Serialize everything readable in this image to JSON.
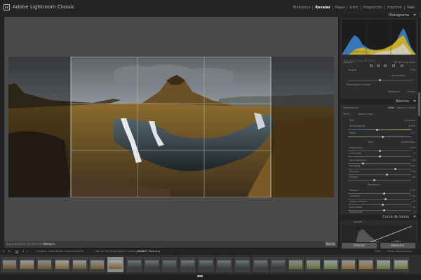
{
  "app": {
    "logo": "Lr",
    "title": "Adobe Lightroom Classic"
  },
  "modules": [
    "Biblioteca",
    "Revelar",
    "Mapa",
    "Libro",
    "Proyección",
    "Imprimir",
    "Web"
  ],
  "active_module": "Revelar",
  "colors": {
    "accent_yellow": "#d6b11b",
    "accent_blue": "#3d87d0",
    "panel_bg": "#2c2c2c",
    "canvas_bg": "#4a4a4a"
  },
  "right_panel": {
    "histogram_title": "Histograma",
    "histogram_info": "ISO 100    24 mm    f/8    1/60 s",
    "histogram_check": "Fotografía original",
    "crop_section": {
      "aspect_label": "Aspecto :",
      "aspect_value": "Tal como se tomó",
      "angle_label": "Ángulo",
      "angle_value": "0,00",
      "auto_label": "Automático",
      "constrain_label": "Restringir a recorte",
      "reset_label": "Restaurar",
      "close_label": "Cerrar"
    },
    "basic_title": "Básicos",
    "basic": {
      "treatment_label": "Tratamiento :",
      "color_label": "Color",
      "bw_label": "Blanco y negro",
      "profile_label": "Perfil :",
      "profile_value": "Adobe Color",
      "wb_label": "WB :",
      "wb_value": "Al tomar",
      "temp_label": "Temperatura",
      "temp_value": "4.500",
      "tint_label": "Matiz",
      "tint_value": "+ 7",
      "tone_label": "Tono",
      "tone_auto": "Automático",
      "exposure_label": "Exposición",
      "exposure_value": "0,00",
      "contrast_label": "Contraste",
      "contrast_value": "0",
      "highlights_label": "Iluminaciones",
      "highlights_value": "- 58",
      "shadows_label": "Sombras",
      "shadows_value": "+ 52",
      "whites_label": "Blancos",
      "whites_value": "+ 20",
      "blacks_label": "Negros",
      "blacks_value": "- 18",
      "presence_label": "Presencia",
      "texture_label": "Textura",
      "texture_value": "+ 12",
      "clarity_label": "Claridad",
      "clarity_value": "+ 18",
      "dehaze_label": "Quitar neblina",
      "dehaze_value": "+ 8",
      "vibrance_label": "Intensidad",
      "vibrance_value": "+ 14",
      "saturation_label": "Saturación",
      "saturation_value": "0"
    },
    "curve_title": "Curva de tonos",
    "curve_channel": "Ajustar",
    "prev_button": "Anterior",
    "reset_button": "Restaurar"
  },
  "center_toolbar": {
    "left_text": "Superposición de herramientas :",
    "mode_text": "Siempre",
    "done": "Hecho"
  },
  "filmstrip": {
    "page1": "1",
    "page2": "2",
    "source_text": "Carpeta : Importación Carrera anterior",
    "count_text": "262 de 349 fotografías / 1 seleccionada /",
    "filename": "_MG3879-Pano.dng",
    "filter_label": "Filtro :",
    "filter_value": "Filtros desactivados"
  }
}
